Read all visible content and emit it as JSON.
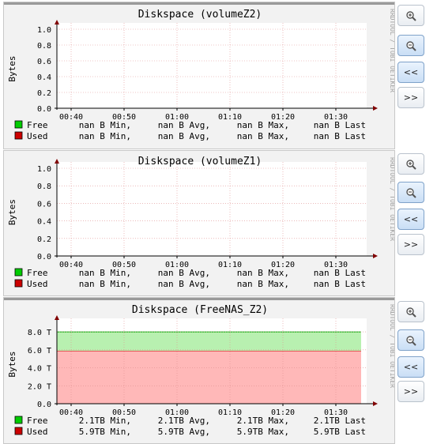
{
  "buttons": {
    "zoom_in_icon": "zoom-in-icon",
    "zoom_out_icon": "zoom-out-icon",
    "back_label": "<<",
    "forward_label": ">>"
  },
  "chart_data": [
    {
      "type": "area",
      "title": "Diskspace (volumeZ2)",
      "ylabel": "Bytes",
      "watermark": "RRDTOOL / TOBI OETIKER",
      "x_ticks": [
        "00:40",
        "00:50",
        "01:00",
        "01:10",
        "01:20",
        "01:30"
      ],
      "y_ticks": [
        "0.0",
        "0.2",
        "0.4",
        "0.6",
        "0.8",
        "1.0"
      ],
      "ylim": [
        0,
        1
      ],
      "grid": true,
      "series": [],
      "legend": [
        {
          "label": "Free",
          "color": "#00cc00",
          "min": "nan B Min,",
          "avg": "nan B Avg,",
          "max": "nan B Max,",
          "last": "nan B Last"
        },
        {
          "label": "Used",
          "color": "#cc0000",
          "min": "nan B Min,",
          "avg": "nan B Avg,",
          "max": "nan B Max,",
          "last": "nan B Last"
        }
      ]
    },
    {
      "type": "area",
      "title": "Diskspace (volumeZ1)",
      "ylabel": "Bytes",
      "watermark": "RRDTOOL / TOBI OETIKER",
      "x_ticks": [
        "00:40",
        "00:50",
        "01:00",
        "01:10",
        "01:20",
        "01:30"
      ],
      "y_ticks": [
        "0.0",
        "0.2",
        "0.4",
        "0.6",
        "0.8",
        "1.0"
      ],
      "ylim": [
        0,
        1
      ],
      "grid": true,
      "series": [],
      "legend": [
        {
          "label": "Free",
          "color": "#00cc00",
          "min": "nan B Min,",
          "avg": "nan B Avg,",
          "max": "nan B Max,",
          "last": "nan B Last"
        },
        {
          "label": "Used",
          "color": "#cc0000",
          "min": "nan B Min,",
          "avg": "nan B Avg,",
          "max": "nan B Max,",
          "last": "nan B Last"
        }
      ]
    },
    {
      "type": "area",
      "title": "Diskspace (FreeNAS_Z2)",
      "ylabel": "Bytes",
      "watermark": "RRDTOOL / TOBI OETIKER",
      "x_ticks": [
        "00:40",
        "00:50",
        "01:00",
        "01:10",
        "01:20",
        "01:30"
      ],
      "y_ticks": [
        "0.0",
        "2.0 T",
        "4.0 T",
        "6.0 T",
        "8.0 T"
      ],
      "ylim": [
        0,
        8.8
      ],
      "grid": true,
      "stacked": true,
      "series": [
        {
          "name": "Used",
          "value_tb": 5.9,
          "fill": "#ffb8b8",
          "line": "#cc0000"
        },
        {
          "name": "Free",
          "value_tb": 2.1,
          "fill": "#b8f0b0",
          "line": "#00aa00"
        }
      ],
      "legend": [
        {
          "label": "Free",
          "color": "#00cc00",
          "min": "2.1TB Min,",
          "avg": "2.1TB Avg,",
          "max": "2.1TB Max,",
          "last": "2.1TB Last"
        },
        {
          "label": "Used",
          "color": "#cc0000",
          "min": "5.9TB Min,",
          "avg": "5.9TB Avg,",
          "max": "5.9TB Max,",
          "last": "5.9TB Last"
        }
      ]
    }
  ]
}
